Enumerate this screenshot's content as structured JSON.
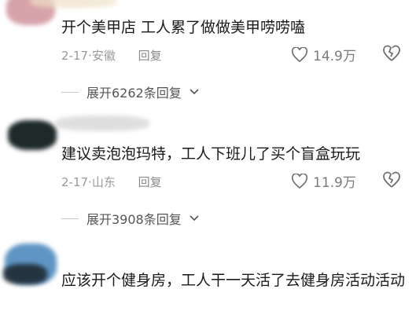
{
  "comments": [
    {
      "text": "开个美甲店 工人累了做做美甲唠唠嗑",
      "date": "2-17",
      "location": "安徽",
      "reply_label": "回复",
      "likes": "14.9万",
      "expand_label": "展开6262条回复"
    },
    {
      "text": "建议卖泡泡玛特，工人下班儿了买个盲盒玩玩",
      "date": "2-17",
      "location": "山东",
      "reply_label": "回复",
      "likes": "11.9万",
      "expand_label": "展开3908条回复"
    },
    {
      "text": "应该开个健身房，工人干一天活了去健身房活动活动"
    }
  ],
  "icons": [
    "heart-icon",
    "broken-heart-icon",
    "chevron-down-icon"
  ],
  "colors": {
    "text": "#1a1a1a",
    "meta": "#999999",
    "blob1": "#d9a7ad",
    "blob2": "#1e2a2a",
    "blob3": "#6f9ec6"
  }
}
